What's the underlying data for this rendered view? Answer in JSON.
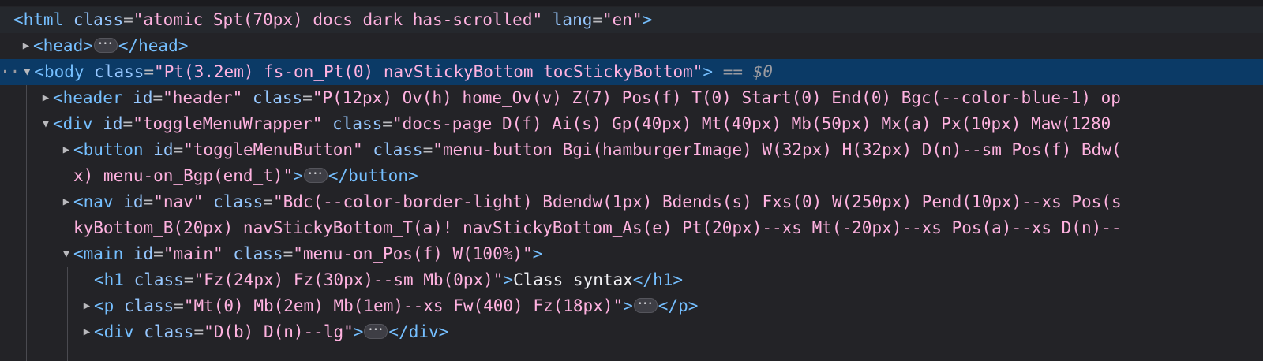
{
  "lines": {
    "html_tag": "<html",
    "html_class_attr": "class",
    "html_class_val": "\"atomic Spt(70px) docs dark has-scrolled\"",
    "html_lang_attr": "lang",
    "html_lang_val": "\"en\"",
    "html_close": ">",
    "head_open": "<head>",
    "head_close": "</head>",
    "body_tag": "<body",
    "body_class_attr": "class",
    "body_class_val": "\"Pt(3.2em) fs-on_Pt(0) navStickyBottom tocStickyBottom\"",
    "body_close": ">",
    "body_marker": "==",
    "body_var": "$0",
    "header_tag": "<header",
    "header_id_attr": "id",
    "header_id_val": "\"header\"",
    "header_class_attr": "class",
    "header_class_val": "\"P(12px) Ov(h) home_Ov(v) Z(7) Pos(f) T(0) Start(0) End(0) Bgc(--color-blue-1) op",
    "div_tag": "<div",
    "div_id_attr": "id",
    "div_id_val": "\"toggleMenuWrapper\"",
    "div_class_attr": "class",
    "div_class_val": "\"docs-page D(f) Ai(s) Gp(40px) Mt(40px) Mb(50px) Mx(a) Px(10px) Maw(1280",
    "button_tag": "<button",
    "button_id_attr": "id",
    "button_id_val": "\"toggleMenuButton\"",
    "button_class_attr": "class",
    "button_class_val": "\"menu-button Bgi(hamburgerImage) W(32px) H(32px) D(n)--sm Pos(f) Bdw(",
    "button_cont": "x) menu-on_Bgp(end_t)\"",
    "button_gt": ">",
    "button_close": "</button>",
    "nav_tag": "<nav",
    "nav_id_attr": "id",
    "nav_id_val": "\"nav\"",
    "nav_class_attr": "class",
    "nav_class_val": "\"Bdc(--color-border-light) Bdendw(1px) Bdends(s) Fxs(0) W(250px) Pend(10px)--xs Pos(s",
    "nav_cont": "kyBottom_B(20px) navStickyBottom_T(a)! navStickyBottom_As(e) Pt(20px)--xs Mt(-20px)--xs Pos(a)--xs D(n)--",
    "main_tag": "<main",
    "main_id_attr": "id",
    "main_id_val": "\"main\"",
    "main_class_attr": "class",
    "main_class_val": "\"menu-on_Pos(f) W(100%)\"",
    "main_close": ">",
    "h1_tag": "<h1",
    "h1_class_attr": "class",
    "h1_class_val": "\"Fz(24px) Fz(30px)--sm Mb(0px)\"",
    "h1_gt": ">",
    "h1_text": "Class syntax",
    "h1_close": "</h1>",
    "p_tag": "<p",
    "p_class_attr": "class",
    "p_class_val": "\"Mt(0) Mb(2em) Mb(1em)--xs Fw(400) Fz(18px)\"",
    "p_gt": ">",
    "p_close": "</p>",
    "div2_tag": "<div",
    "div2_class_attr": "class",
    "div2_class_val": "\"D(b) D(n)--lg\"",
    "div2_gt": ">",
    "div2_close": "</div>"
  },
  "icons": {
    "expanded": "expanded-triangle-icon",
    "collapsed": "collapsed-triangle-icon",
    "ellipsis": "ellipsis-badge-icon",
    "drag": "drag-handle-icon"
  },
  "colors": {
    "background": "#232327",
    "selection": "#0b3a66",
    "tag": "#75bfff",
    "attribute_value": "#ffb2e0"
  }
}
